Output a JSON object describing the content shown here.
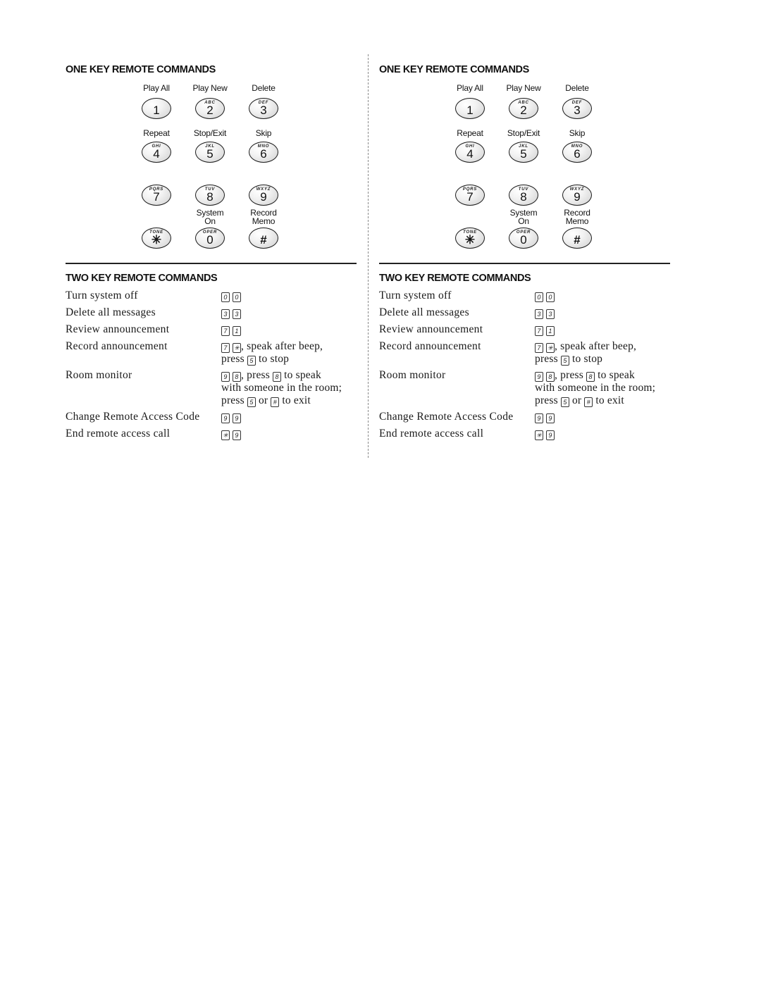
{
  "one_key": {
    "heading": "ONE KEY REMOTE COMMANDS",
    "keys": [
      {
        "label_top": "Play All",
        "letters": "",
        "digit": "1"
      },
      {
        "label_top": "Play New",
        "letters": "ABC",
        "digit": "2"
      },
      {
        "label_top": "Delete",
        "letters": "DEF",
        "digit": "3"
      },
      {
        "label_top": "Repeat",
        "letters": "GHI",
        "digit": "4"
      },
      {
        "label_top": "Stop/Exit",
        "letters": "JKL",
        "digit": "5"
      },
      {
        "label_top": "Skip",
        "letters": "MNO",
        "digit": "6"
      },
      {
        "label_top": "",
        "letters": "PQRS",
        "digit": "7"
      },
      {
        "label_top": "",
        "letters": "TUV",
        "digit": "8"
      },
      {
        "label_top": "",
        "letters": "WXYZ",
        "digit": "9"
      },
      {
        "label_top": "",
        "letters": "TONE",
        "digit": "✳"
      },
      {
        "label_top": "System On",
        "label_line1": "System",
        "label_line2": "On",
        "letters": "OPER",
        "digit": "0"
      },
      {
        "label_top": "Record Memo",
        "label_line1": "Record",
        "label_line2": "Memo",
        "letters": "",
        "digit": "#"
      }
    ]
  },
  "two_key": {
    "heading": "TWO KEY REMOTE COMMANDS",
    "commands": [
      {
        "name": "Turn system off",
        "keys": [
          "0",
          "0"
        ],
        "lines": [
          ""
        ]
      },
      {
        "name": "Delete all messages",
        "keys": [
          "3",
          "3"
        ],
        "lines": [
          ""
        ]
      },
      {
        "name": "Review announcement",
        "keys": [
          "7",
          "1"
        ],
        "lines": [
          ""
        ]
      },
      {
        "name": "Record announcement",
        "keys": [
          "7",
          "✳"
        ],
        "lines": [
          ", speak after beep,",
          "press",
          "to stop"
        ],
        "inline_key_1": "5"
      },
      {
        "name": "Room monitor",
        "keys": [
          "9",
          "8"
        ],
        "lines": [
          ", press",
          "to speak",
          "with someone in the room;",
          "press",
          "or",
          "to exit"
        ],
        "inline_key_1": "8",
        "inline_key_2": "5",
        "inline_key_3": "#"
      },
      {
        "name": "Change Remote Access Code",
        "keys": [
          "9",
          "9"
        ],
        "lines": [
          ""
        ]
      },
      {
        "name": "End remote access call",
        "keys": [
          "✳",
          "9"
        ],
        "lines": [
          ""
        ]
      }
    ]
  },
  "colors": {
    "text": "#1a1a1a",
    "key_border": "#1a1a1a",
    "key_fill": "#f2f2f2",
    "divider": "#8a8a8a"
  }
}
